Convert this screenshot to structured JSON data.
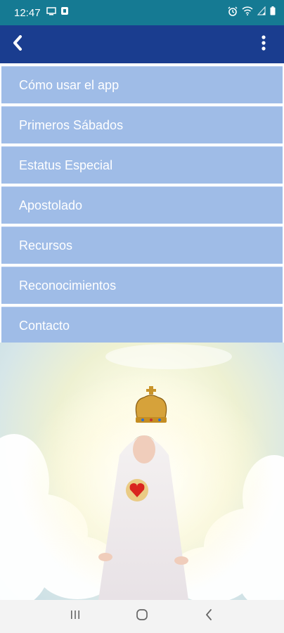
{
  "status_bar": {
    "time": "12:47",
    "icons": [
      "monitor-icon",
      "shield-notification-icon",
      "alarm-icon",
      "wifi-icon",
      "signal-icon",
      "battery-icon"
    ]
  },
  "app_bar": {
    "back_icon": "chevron-left-icon",
    "overflow_icon": "more-vertical-icon"
  },
  "menu": {
    "items": [
      {
        "label": "Cómo usar el app"
      },
      {
        "label": "Primeros Sábados"
      },
      {
        "label": "Estatus Especial"
      },
      {
        "label": "Apostolado"
      },
      {
        "label": "Recursos"
      },
      {
        "label": "Reconocimientos"
      },
      {
        "label": "Contacto"
      }
    ]
  },
  "colors": {
    "status_bar": "#157a93",
    "app_bar": "#1a3d8f",
    "menu_item": "#9fbce7",
    "menu_text": "#ffffff"
  },
  "nav_bar": {
    "icons": [
      "recent-apps-icon",
      "home-icon",
      "back-icon"
    ]
  }
}
